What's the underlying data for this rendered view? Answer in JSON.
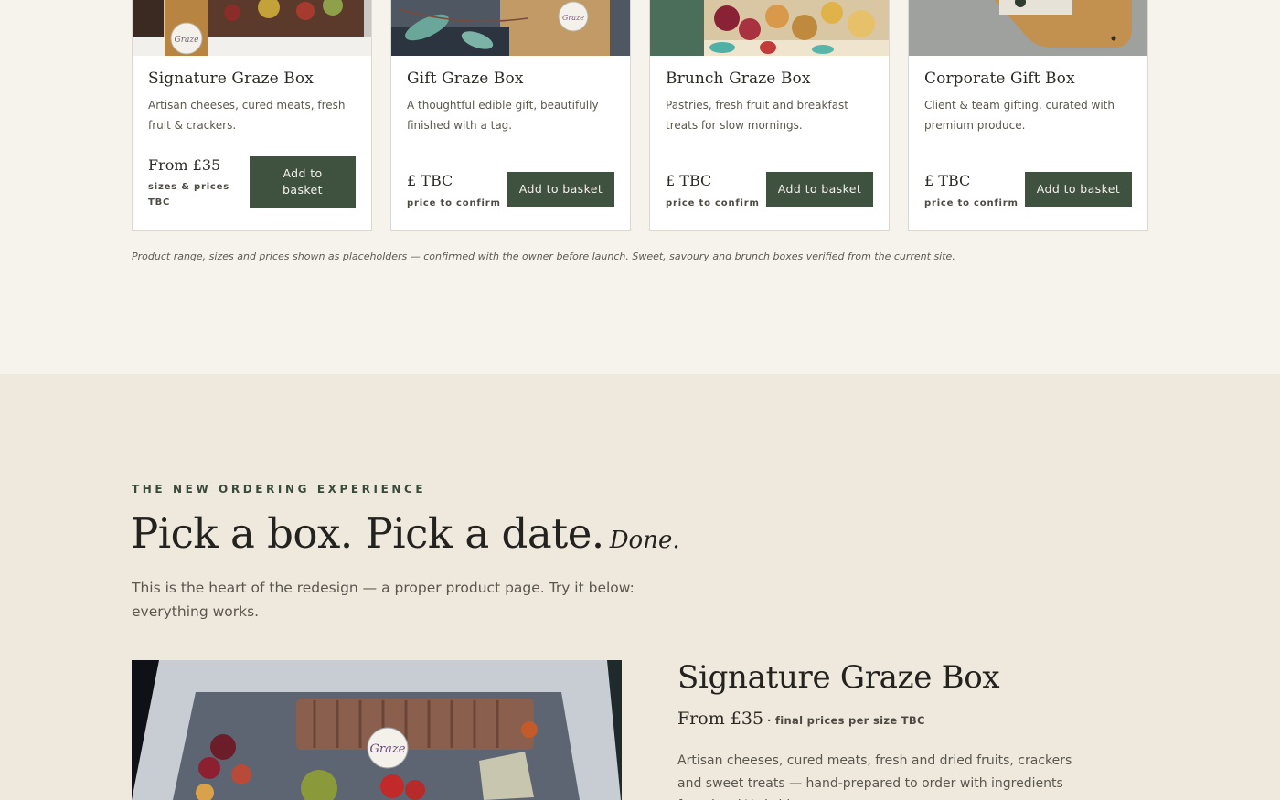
{
  "products": [
    {
      "title": "Signature Graze Box",
      "description": "Artisan cheeses, cured meats, fresh fruit & crackers.",
      "price": "From £35",
      "price_note": "sizes & prices TBC",
      "button": "Add to basket"
    },
    {
      "title": "Gift Graze Box",
      "description": "A thoughtful edible gift, beautifully finished with a tag.",
      "price": "£ TBC",
      "price_note": "price to confirm",
      "button": "Add to basket"
    },
    {
      "title": "Brunch Graze Box",
      "description": "Pastries, fresh fruit and breakfast treats for slow mornings.",
      "price": "£ TBC",
      "price_note": "price to confirm",
      "button": "Add to basket"
    },
    {
      "title": "Corporate Gift Box",
      "description": "Client & team gifting, curated with premium produce.",
      "price": "£ TBC",
      "price_note": "price to confirm",
      "button": "Add to basket"
    }
  ],
  "disclaimer": "Product range, sizes and prices shown as placeholders — confirmed with the owner before launch. Sweet, savoury and brunch boxes verified from the current site.",
  "ordering": {
    "eyebrow": "THE NEW ORDERING EXPERIENCE",
    "headline": "Pick a box. Pick a date.",
    "headline_accent": "Done.",
    "lede": "This is the heart of the redesign — a proper product page. Try it below: everything works."
  },
  "detail": {
    "title": "Signature Graze Box",
    "price": "From £35",
    "price_note": "· final prices per size TBC",
    "description": "Artisan cheeses, cured meats, fresh and dried fruits, crackers and sweet treats — hand-prepared to order with ingredients from local Yorkshire"
  },
  "colors": {
    "accent_green": "#3f5240",
    "page_bg": "#f6f3ec",
    "section_bg": "#efe8dc"
  },
  "icons": [
    "graze-logo-sticker"
  ]
}
